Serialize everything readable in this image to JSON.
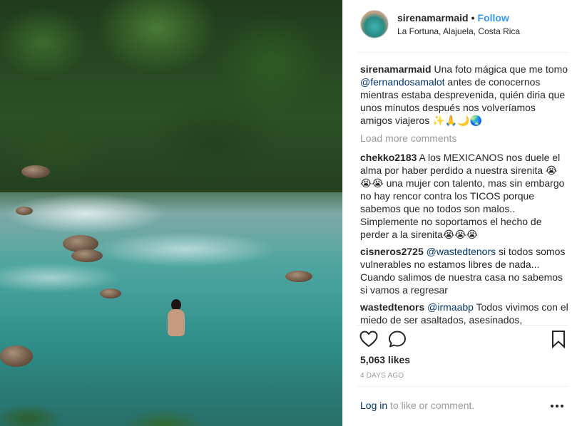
{
  "header": {
    "username": "sirenamarmaid",
    "separator": "•",
    "follow_label": "Follow",
    "location": "La Fortuna, Alajuela, Costa Rica"
  },
  "caption": {
    "username": "sirenamarmaid",
    "text_before": "Una foto mágica que me tomo",
    "mention": "@fernandosamalot",
    "text_after": "antes de conocernos mientras estaba desprevenida, quién diria que unos minutos después nos volveríamos amigos viajeros ✨🙏🌙🌏"
  },
  "load_more_label": "Load more comments",
  "comments": [
    {
      "username": "chekko2183",
      "mention": "",
      "text": "A los MEXICANOS nos duele el alma por haber perdido a nuestra sirenita 😭😭😭 una mujer con talento, mas sin embargo no hay rencor contra los TICOS porque sabemos que no todos son malos.. Simplemente no soportamos el hecho de perder a la sirenita😭😭😭"
    },
    {
      "username": "cisneros2725",
      "mention": "@wastedtenors",
      "text": "si todos somos vulnerables no estamos libres de nada... Cuando salimos de nuestra casa no sabemos si vamos a regresar"
    },
    {
      "username": "wastedtenors",
      "mention": "@irmaabp",
      "text": "Todos vivimos con el miedo de ser asaltados, asesinados,"
    }
  ],
  "likes": "5,063 likes",
  "timestamp": "4 DAYS AGO",
  "login": {
    "link": "Log in",
    "rest": "to like or comment."
  },
  "icons": {
    "like": "heart-icon",
    "comment": "comment-icon",
    "save": "bookmark-icon",
    "more": "more-options-icon"
  },
  "colors": {
    "link_blue": "#3897f0",
    "mention_blue": "#003569",
    "muted": "#999999",
    "text": "#262626"
  }
}
